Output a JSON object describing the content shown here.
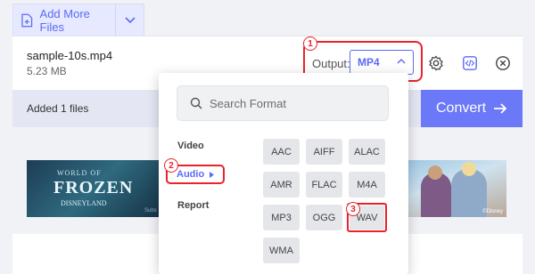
{
  "toolbar": {
    "add_more_label": "Add More Files"
  },
  "file": {
    "name": "sample-10s.mp4",
    "size": "5.23 MB"
  },
  "output": {
    "label": "Output:",
    "selected": "MP4"
  },
  "status": {
    "added_text": "Added 1 files"
  },
  "convert": {
    "label": "Convert"
  },
  "ad": {
    "left_line1": "WORLD OF",
    "left_line2": "FROZEN",
    "left_line3": "DISNEYLAND",
    "left_credit": "Subs",
    "right_credit": "©Disney"
  },
  "dropdown": {
    "search_placeholder": "Search Format",
    "categories": [
      "Video",
      "Audio",
      "Report"
    ],
    "formats": [
      "AAC",
      "AIFF",
      "ALAC",
      "AMR",
      "FLAC",
      "M4A",
      "MP3",
      "OGG",
      "WAV",
      "WMA"
    ]
  },
  "annotations": [
    "1",
    "2",
    "3"
  ],
  "colors": {
    "accent": "#5b6bf5",
    "convert_bg": "#6b78f7",
    "highlight": "#e8232b"
  }
}
